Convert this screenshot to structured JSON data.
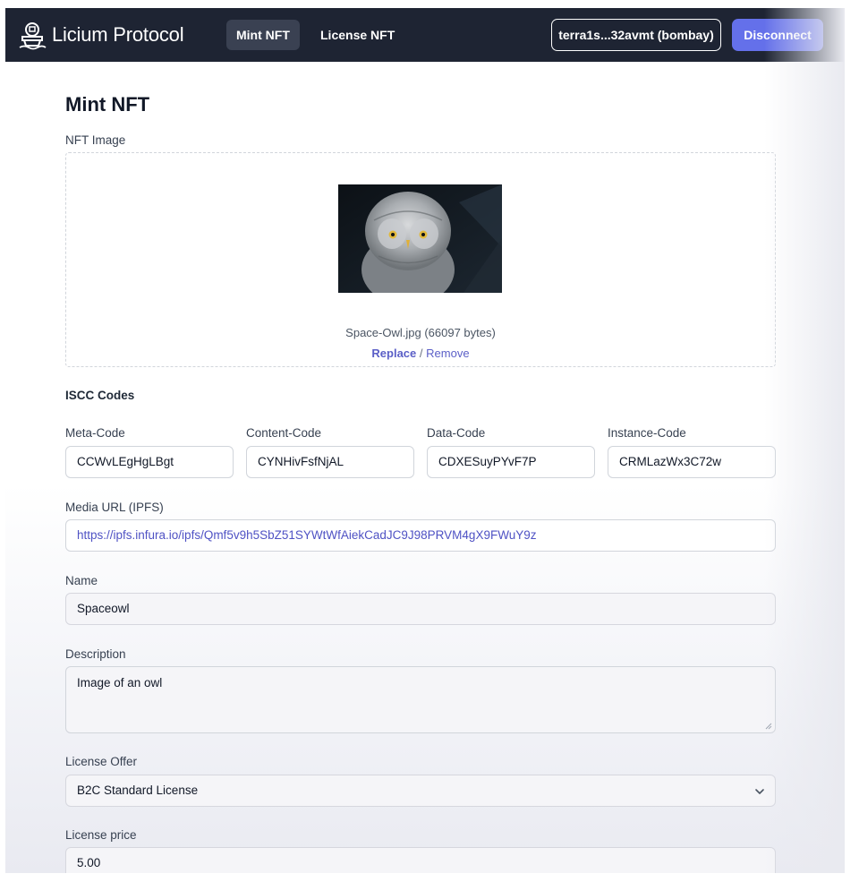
{
  "header": {
    "brand": "Licium Protocol",
    "nav": [
      {
        "label": "Mint NFT",
        "active": true
      },
      {
        "label": "License NFT",
        "active": false
      }
    ],
    "wallet": "terra1s...32avmt (bombay)",
    "disconnect_label": "Disconnect"
  },
  "page": {
    "title": "Mint NFT",
    "nft_image": {
      "label": "NFT Image",
      "file_name": "Space-Owl.jpg (66097 bytes)",
      "replace_label": "Replace",
      "separator": "/",
      "remove_label": "Remove"
    },
    "iscc": {
      "section_title": "ISCC Codes",
      "codes": [
        {
          "label": "Meta-Code",
          "value": "CCWvLEgHgLBgt"
        },
        {
          "label": "Content-Code",
          "value": "CYNHivFsfNjAL"
        },
        {
          "label": "Data-Code",
          "value": "CDXESuyPYvF7P"
        },
        {
          "label": "Instance-Code",
          "value": "CRMLazWx3C72w"
        }
      ]
    },
    "media_url": {
      "label": "Media URL (IPFS)",
      "value": "https://ipfs.infura.io/ipfs/Qmf5v9h5SbZ51SYWtWfAiekCadJC9J98PRVM4gX9FWuY9z"
    },
    "name": {
      "label": "Name",
      "value": "Spaceowl"
    },
    "description": {
      "label": "Description",
      "value": "Image of an owl"
    },
    "license_offer": {
      "label": "License Offer",
      "value": "B2C Standard License"
    },
    "license_price": {
      "label": "License price",
      "value": "5.00"
    }
  },
  "colors": {
    "navbar": "#1e2433",
    "accent": "#6470ea",
    "link": "#5b5fc7"
  },
  "icons": [
    "licium-logo-icon",
    "chevron-down-icon",
    "resize-grip-icon"
  ]
}
